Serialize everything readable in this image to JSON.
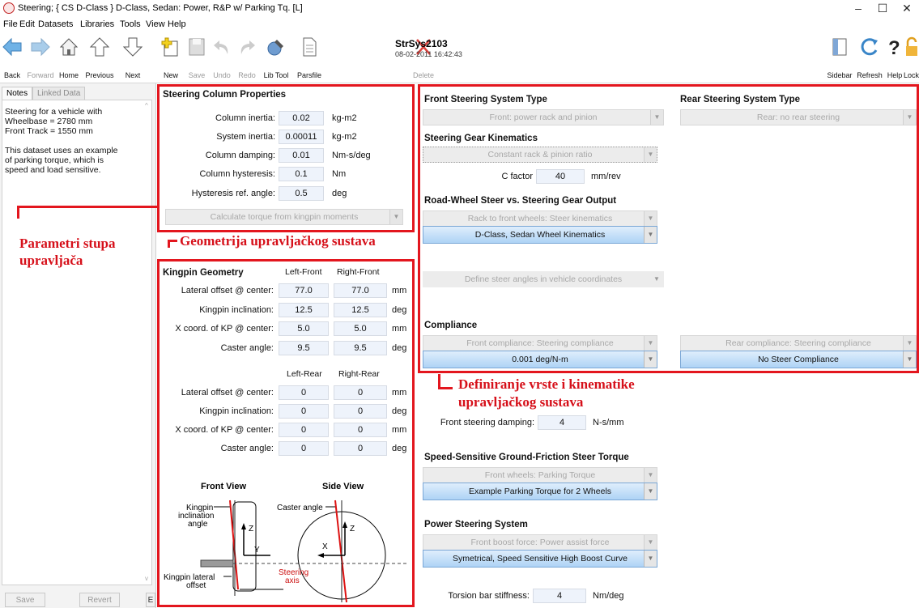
{
  "window": {
    "title": "Steering;  { CS D-Class }  D-Class, Sedan: Power, R&P w/ Parking Tq. [L]"
  },
  "menu": [
    "File",
    "Edit",
    "Datasets",
    "Libraries",
    "Tools",
    "View",
    "Help"
  ],
  "toolbar": {
    "back": "Back",
    "forward": "Forward",
    "home": "Home",
    "previous": "Previous",
    "next": "Next",
    "new": "New",
    "save": "Save",
    "undo": "Undo",
    "redo": "Redo",
    "lib_tool": "Lib Tool",
    "parsfile": "Parsfile",
    "dataset_name": "StrSys2103",
    "dataset_date": "08-02-2011 16:42:43",
    "delete": "Delete",
    "sidebar": "Sidebar",
    "refresh": "Refresh",
    "help": "Help",
    "lock": "Lock"
  },
  "sidebar": {
    "tabs": [
      "Notes",
      "Linked Data"
    ],
    "notes": [
      "Steering for a vehicle with",
      "Wheelbase = 2780 mm",
      "Front Track = 1550 mm",
      "",
      "This dataset uses an example",
      "of parking torque, which is",
      "speed and load sensitive."
    ],
    "buttons": [
      "Save",
      "Revert",
      "E"
    ]
  },
  "column": {
    "title": "Steering Column Properties",
    "rows": [
      {
        "label": "Column inertia:",
        "value": "0.02",
        "unit": "kg-m2"
      },
      {
        "label": "System inertia:",
        "value": "0.00011",
        "unit": "kg-m2"
      },
      {
        "label": "Column damping:",
        "value": "0.01",
        "unit": "Nm-s/deg"
      },
      {
        "label": "Column hysteresis:",
        "value": "0.1",
        "unit": "Nm"
      },
      {
        "label": "Hysteresis ref. angle:",
        "value": "0.5",
        "unit": "deg"
      }
    ],
    "dropdown": "Calculate torque from kingpin moments"
  },
  "kingpin": {
    "title": "Kingpin Geometry",
    "col_lf": "Left-Front",
    "col_rf": "Right-Front",
    "col_lr": "Left-Rear",
    "col_rr": "Right-Rear",
    "front_rows": [
      {
        "label": "Lateral offset @ center:",
        "l": "77.0",
        "r": "77.0",
        "unit": "mm"
      },
      {
        "label": "Kingpin inclination:",
        "l": "12.5",
        "r": "12.5",
        "unit": "deg"
      },
      {
        "label": "X coord. of KP @ center:",
        "l": "5.0",
        "r": "5.0",
        "unit": "mm"
      },
      {
        "label": "Caster angle:",
        "l": "9.5",
        "r": "9.5",
        "unit": "deg"
      }
    ],
    "rear_rows": [
      {
        "label": "Lateral offset @ center:",
        "l": "0",
        "r": "0",
        "unit": "mm"
      },
      {
        "label": "Kingpin inclination:",
        "l": "0",
        "r": "0",
        "unit": "deg"
      },
      {
        "label": "X coord. of KP @ center:",
        "l": "0",
        "r": "0",
        "unit": "mm"
      },
      {
        "label": "Caster angle:",
        "l": "0",
        "r": "0",
        "unit": "deg"
      }
    ],
    "diagram": {
      "front_view": "Front View",
      "side_view": "Side View",
      "kp_incl": [
        "Kingpin",
        "inclination",
        "angle"
      ],
      "caster": "Caster angle",
      "kp_lat": [
        "Kingpin lateral",
        "offset"
      ],
      "steer_axis": [
        "Steering",
        "axis"
      ],
      "z": "Z",
      "y": "Y",
      "x": "X"
    }
  },
  "front_system": {
    "title": "Front Steering System Type",
    "dropdown": "Front: power rack and pinion"
  },
  "rear_system": {
    "title": "Rear Steering System Type",
    "dropdown": "Rear: no rear steering"
  },
  "gear": {
    "title": "Steering Gear Kinematics",
    "dropdown": "Constant rack & pinion ratio",
    "c_label": "C factor",
    "c_value": "40",
    "c_unit": "mm/rev"
  },
  "road_wheel": {
    "title": "Road-Wheel Steer vs. Steering Gear Output",
    "dropdown1": "Rack to front wheels: Steer kinematics",
    "dropdown2": "D-Class, Sedan Wheel Kinematics",
    "dropdown3": "Define steer angles in vehicle coordinates"
  },
  "compliance": {
    "title": "Compliance",
    "front_dd": "Front compliance: Steering compliance",
    "front_val": "0.001 deg/N-m",
    "rear_dd": "Rear compliance: Steering compliance",
    "rear_val": "No Steer Compliance"
  },
  "damping": {
    "label": "Front steering damping:",
    "value": "4",
    "unit": "N-s/mm"
  },
  "friction": {
    "title": "Speed-Sensitive Ground-Friction Steer Torque",
    "dropdown1": "Front wheels: Parking Torque",
    "dropdown2": "Example Parking Torque for 2 Wheels"
  },
  "power": {
    "title": "Power Steering System",
    "dropdown1": "Front boost force: Power assist force",
    "dropdown2": "Symetrical, Speed Sensitive High Boost Curve"
  },
  "torsion": {
    "label": "Torsion bar stiffness:",
    "value": "4",
    "unit": "Nm/deg"
  },
  "annotations": {
    "a1_line1": "Parametri stupa",
    "a1_line2": "upravljača",
    "a2": "Geometrija upravljačkog sustava",
    "a3_line1": "Definiranje vrste i kinematike",
    "a3_line2": "upravljačkog sustava"
  },
  "colors": {
    "annotation_red": "#e3161e",
    "blue_link": "#aed3f5"
  }
}
